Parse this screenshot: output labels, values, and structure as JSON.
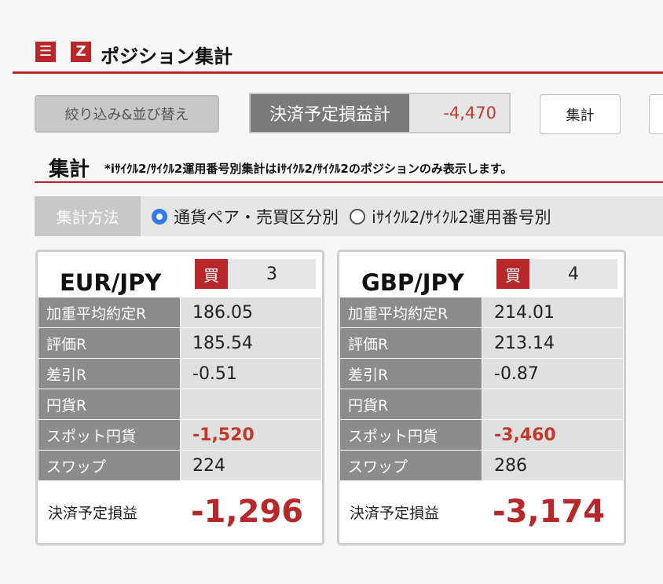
{
  "header": {
    "menu_icon": "☰",
    "logo_icon": "Z",
    "title": "ポジション集計"
  },
  "toolbar": {
    "filter_label": "絞り込み&並び替え",
    "pl_label": "決済予定損益計",
    "pl_value": "-4,470",
    "total_label": "集計"
  },
  "section": {
    "title": "集計",
    "note": "*iｻｲｸﾙ2/ｻｲｸﾙ2運用番号別集計はiｻｲｸﾙ2/ｻｲｸﾙ2のポジションのみ表示します。"
  },
  "method": {
    "label": "集計方法",
    "options": [
      {
        "label": "通貨ペア・売買区分別",
        "selected": true
      },
      {
        "label": "iｻｲｸﾙ2/ｻｲｸﾙ2運用番号別",
        "selected": false
      }
    ]
  },
  "cards": [
    {
      "pair": "EUR/JPY",
      "side": "買",
      "qty": "3",
      "rows": [
        {
          "label": "加重平均約定R",
          "value": "186.05"
        },
        {
          "label": "評価R",
          "value": "185.54"
        },
        {
          "label": "差引R",
          "value": "-0.51"
        },
        {
          "label": "円貨R",
          "value": ""
        },
        {
          "label": "スポット円貨",
          "value": "-1,520"
        },
        {
          "label": "スワップ",
          "value": "224"
        }
      ],
      "settle_label": "決済予定損益",
      "settle_value": "-1,296"
    },
    {
      "pair": "GBP/JPY",
      "side": "買",
      "qty": "4",
      "rows": [
        {
          "label": "加重平均約定R",
          "value": "214.01"
        },
        {
          "label": "評価R",
          "value": "213.14"
        },
        {
          "label": "差引R",
          "value": "-0.87"
        },
        {
          "label": "円貨R",
          "value": ""
        },
        {
          "label": "スポット円貨",
          "value": "-3,460"
        },
        {
          "label": "スワップ",
          "value": "286"
        }
      ],
      "settle_label": "決済予定損益",
      "settle_value": "-3,174"
    }
  ],
  "colors": {
    "brand_red": "#b8282b",
    "negative": "#c0392b",
    "radio_selected": "#2f7be8"
  }
}
